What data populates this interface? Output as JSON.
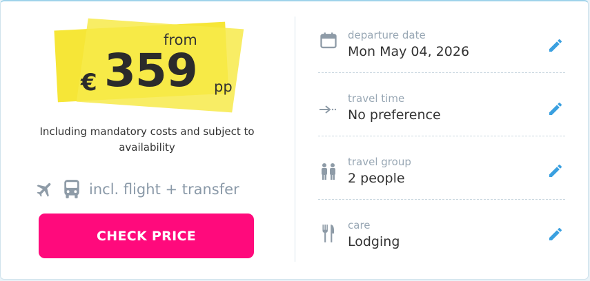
{
  "price": {
    "from_label": "from",
    "currency": "€",
    "amount": "359",
    "per_person": "pp",
    "note": "Including mandatory costs and subject to availability",
    "highlight_color": "#f6e637"
  },
  "includes": {
    "text": "incl. flight + transfer",
    "icons": [
      "airplane-icon",
      "bus-icon"
    ]
  },
  "cta": {
    "label": "CHECK PRICE",
    "color": "#ff0a7c"
  },
  "details": [
    {
      "icon": "calendar-icon",
      "label": "departure date",
      "value": "Mon May 04, 2026"
    },
    {
      "icon": "arrow-right-icon",
      "label": "travel time",
      "value": "No preference"
    },
    {
      "icon": "people-icon",
      "label": "travel group",
      "value": "2 people"
    },
    {
      "icon": "fork-knife-icon",
      "label": "care",
      "value": "Lodging"
    }
  ],
  "edit_icon_color": "#3aa0e0"
}
